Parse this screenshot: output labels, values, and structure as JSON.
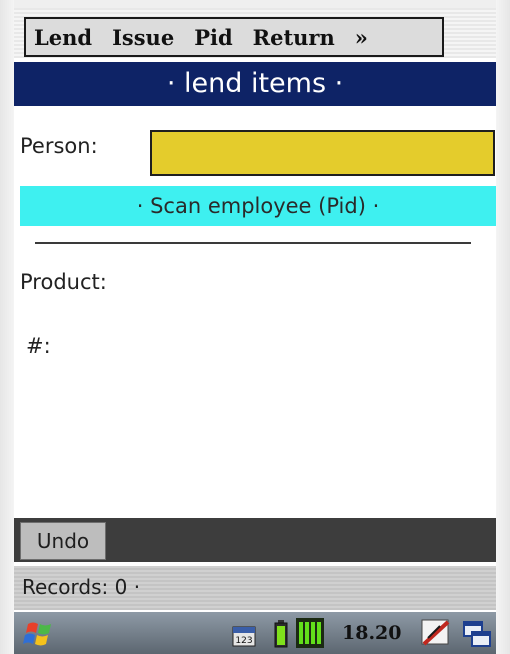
{
  "menu": {
    "items": [
      "Lend",
      "Issue",
      "Pid",
      "Return"
    ],
    "more_label": "»"
  },
  "title": "· lend items ·",
  "form": {
    "person_label": "Person:",
    "person_value": "",
    "scan_prompt": "· Scan employee (Pid) ·",
    "product_label": "Product:",
    "quantity_label": "#:"
  },
  "toolbar": {
    "undo_label": "Undo"
  },
  "status": {
    "records_text": "Records: 0 ·"
  },
  "taskbar": {
    "clock": "18.20",
    "icons": [
      "windows-start-icon",
      "keyboard-123-icon",
      "battery-icon",
      "signal-icon",
      "pen-input-icon",
      "window-switch-icon"
    ]
  },
  "colors": {
    "title_bar": "#0e2366",
    "person_field": "#e4cc2c",
    "scan_banner": "#3ef0f0",
    "toolbar": "#3d3d3d"
  }
}
